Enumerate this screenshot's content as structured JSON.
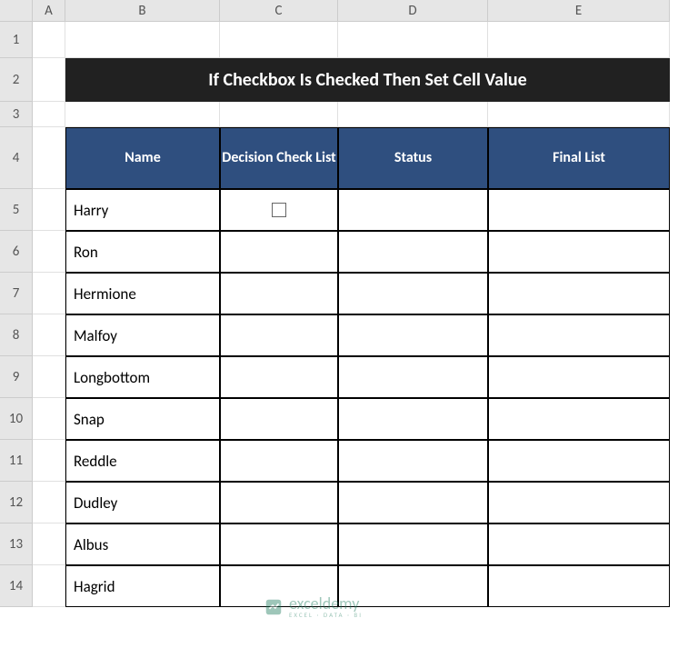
{
  "columns": [
    "A",
    "B",
    "C",
    "D",
    "E"
  ],
  "rows": [
    "1",
    "2",
    "3",
    "4",
    "5",
    "6",
    "7",
    "8",
    "9",
    "10",
    "11",
    "12",
    "13",
    "14"
  ],
  "title": "If Checkbox Is Checked Then Set Cell Value",
  "headers": {
    "name": "Name",
    "decision": "Decision Check List",
    "status": "Status",
    "final": "Final List"
  },
  "names": [
    "Harry",
    "Ron",
    "Hermione",
    "Malfoy",
    "Longbottom",
    "Snap",
    "Reddle",
    "Dudley",
    "Albus",
    "Hagrid"
  ],
  "checkbox_row": 0,
  "watermark": {
    "main": "exceldemy",
    "sub": "EXCEL · DATA · BI"
  }
}
